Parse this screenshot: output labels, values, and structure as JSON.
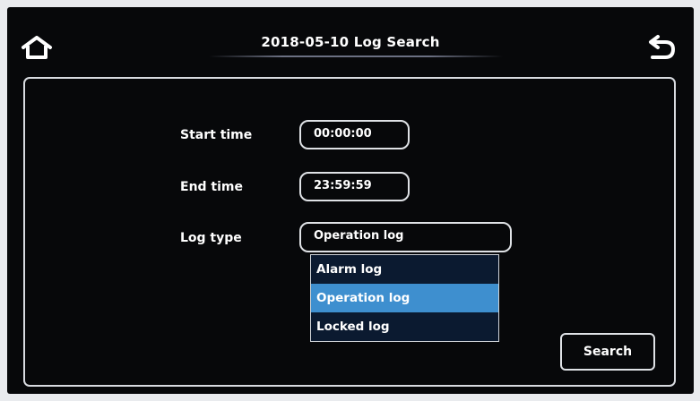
{
  "header": {
    "title": "2018-05-10  Log Search",
    "home_icon": "home-icon",
    "back_icon": "back-arrow-icon"
  },
  "form": {
    "start_time": {
      "label": "Start time",
      "value": "00:00:00"
    },
    "end_time": {
      "label": "End time",
      "value": "23:59:59"
    },
    "log_type": {
      "label": "Log type",
      "value": "Operation log",
      "options": [
        "Alarm log",
        "Operation log",
        "Locked log"
      ],
      "highlighted_option": "Operation log"
    }
  },
  "actions": {
    "search_label": "Search"
  },
  "colors": {
    "background": "#07080a",
    "text": "#ffffff",
    "highlight": "#3e8fcf",
    "dropdown_bg": "#0b1a30",
    "border": "#dfe2e6"
  }
}
